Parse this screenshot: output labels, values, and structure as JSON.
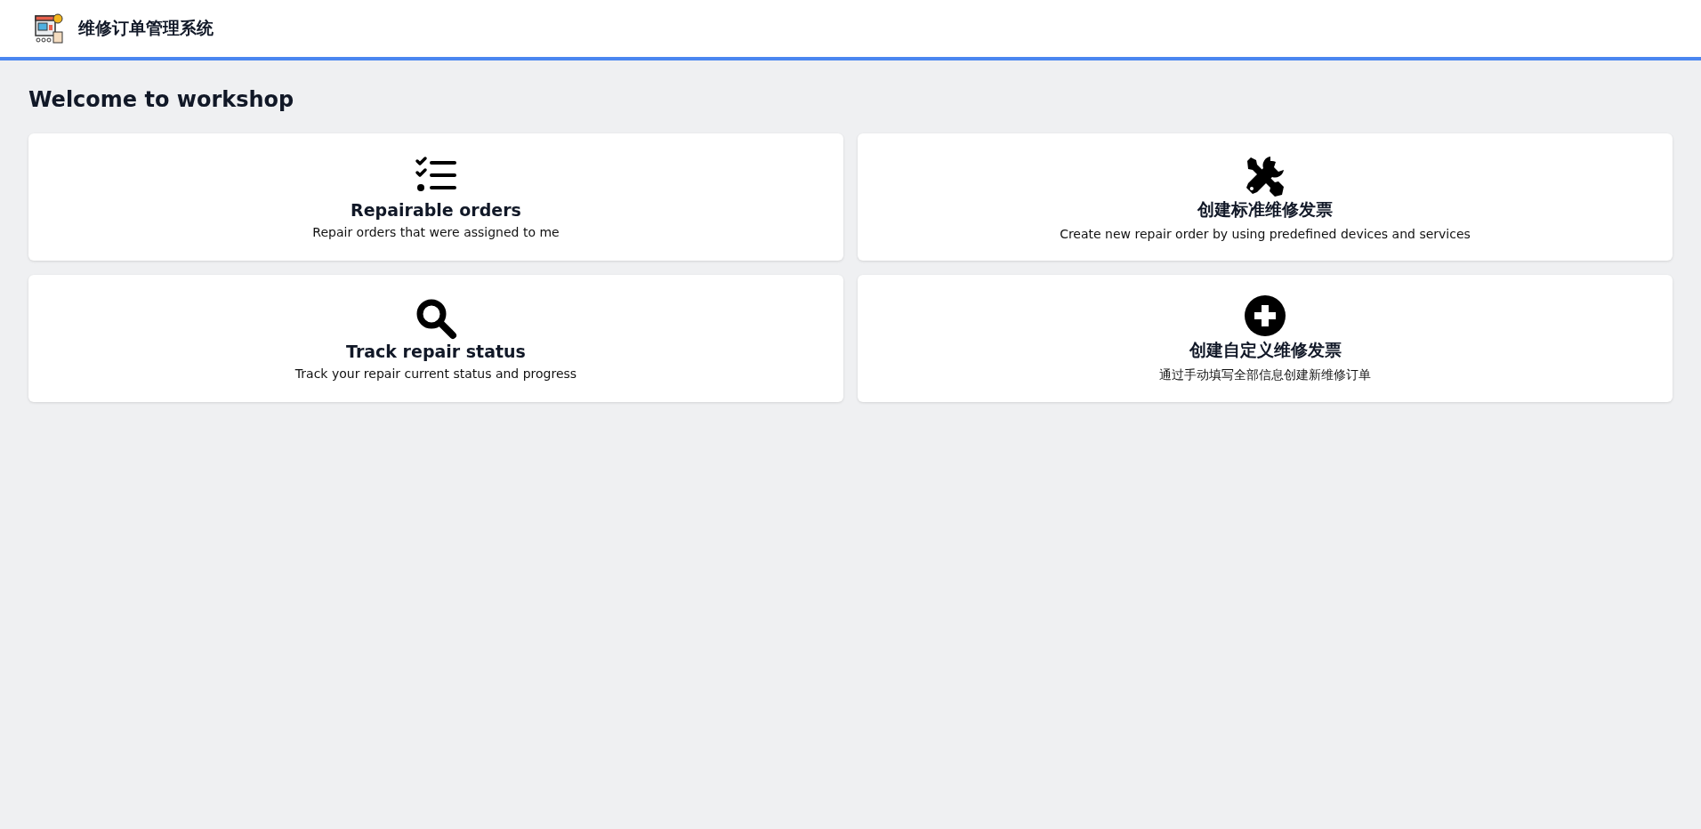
{
  "header": {
    "title": "维修订单管理系统"
  },
  "page": {
    "heading": "Welcome to workshop"
  },
  "cards": [
    {
      "kind": "checklist",
      "title": "Repairable orders",
      "description": "Repair orders that were assigned to me"
    },
    {
      "kind": "tools",
      "title": "创建标准维修发票",
      "description": "Create new repair order by using predefined devices and services"
    },
    {
      "kind": "search",
      "title": "Track repair status",
      "description": "Track your repair current status and progress"
    },
    {
      "kind": "plus",
      "title": "创建自定义维修发票",
      "description": "通过手动填写全部信息创建新维修订单"
    }
  ]
}
